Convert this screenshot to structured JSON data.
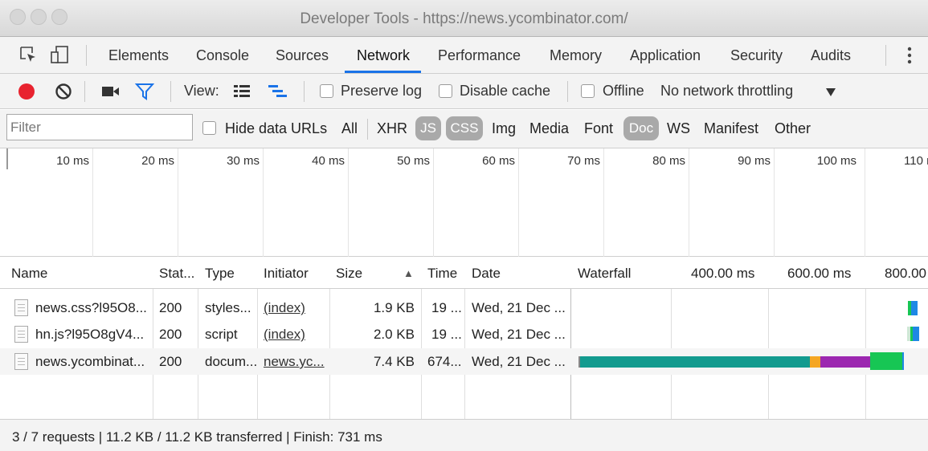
{
  "window": {
    "title": "Developer Tools - https://news.ycombinator.com/"
  },
  "tabs": [
    "Elements",
    "Console",
    "Sources",
    "Network",
    "Performance",
    "Memory",
    "Application",
    "Security",
    "Audits"
  ],
  "active_tab": "Network",
  "toolbar": {
    "view_label": "View:",
    "preserve_log": "Preserve log",
    "disable_cache": "Disable cache",
    "offline": "Offline",
    "throttling": "No network throttling",
    "record_color": "#e8232f",
    "filter_icon_color": "#1a73e8"
  },
  "filter": {
    "placeholder": "Filter",
    "hide_data_urls": "Hide data URLs",
    "types": {
      "all": "All",
      "xhr": "XHR",
      "js": "JS",
      "css": "CSS",
      "img": "Img",
      "media": "Media",
      "font": "Font",
      "doc": "Doc",
      "ws": "WS",
      "manifest": "Manifest",
      "other": "Other"
    },
    "active_types": [
      "JS",
      "CSS",
      "Doc"
    ]
  },
  "overview": {
    "ticks": [
      "10 ms",
      "20 ms",
      "30 ms",
      "40 ms",
      "50 ms",
      "60 ms",
      "70 ms",
      "80 ms",
      "90 ms",
      "100 ms",
      "110 ms"
    ]
  },
  "table": {
    "headers": {
      "name": "Name",
      "status": "Stat...",
      "type": "Type",
      "initiator": "Initiator",
      "size": "Size",
      "sort_arrow": "▲",
      "time": "Time",
      "date": "Date",
      "waterfall": "Waterfall",
      "wf_400": "400.00 ms",
      "wf_600": "600.00 ms",
      "wf_800": "800.00"
    },
    "rows": [
      {
        "name": "news.css?l95O8...",
        "status": "200",
        "type": "styles...",
        "initiator": "(index)",
        "size": "1.9 KB",
        "time": "19 ...",
        "date": "Wed, 21 Dec ..."
      },
      {
        "name": "hn.js?l95O8gV4...",
        "status": "200",
        "type": "script",
        "initiator": "(index)",
        "size": "2.0 KB",
        "time": "19 ...",
        "date": "Wed, 21 Dec ..."
      },
      {
        "name": "news.ycombinat...",
        "status": "200",
        "type": "docum...",
        "initiator": "news.yc...",
        "size": "7.4 KB",
        "time": "674...",
        "date": "Wed, 21 Dec ..."
      }
    ]
  },
  "waterfall_colors": {
    "waiting": "#139b8f",
    "ssl": "#f5a623",
    "ttfb": "#9c27b0",
    "download": "#17c654",
    "receive": "#1e88e5"
  },
  "status": {
    "text": "3 / 7 requests  |  11.2 KB / 11.2 KB transferred  |  Finish: 731 ms"
  }
}
